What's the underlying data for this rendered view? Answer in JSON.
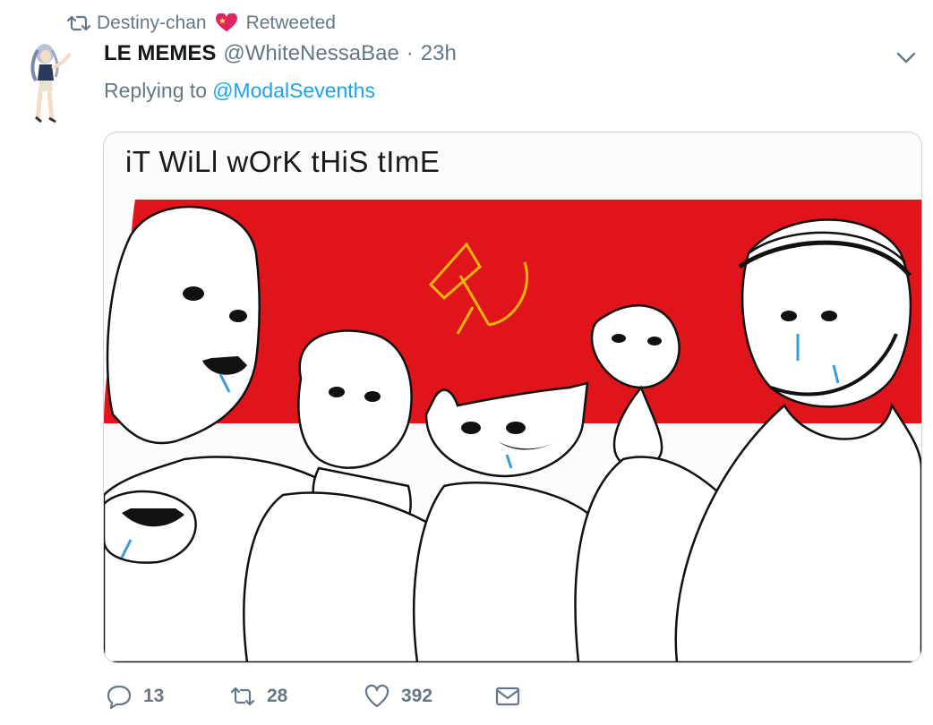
{
  "retweet_context": {
    "retweeter": "Destiny-chan",
    "label": "Retweeted"
  },
  "tweet": {
    "display_name": "LE MEMES",
    "handle": "@WhiteNessaBae",
    "separator": "·",
    "time": "23h",
    "replying_prefix": "Replying to",
    "replying_to": "@ModalSevenths",
    "media": {
      "caption": "iT WiLl wOrK tHiS tImE"
    }
  },
  "actions": {
    "replies": "13",
    "retweets": "28",
    "likes": "392"
  },
  "colors": {
    "secondary_text": "#657786",
    "link": "#1da1f2",
    "meme_red": "#e0141b",
    "hammer_sickle": "#f2b705"
  },
  "icons": [
    "retweet-icon",
    "heart-emoji-icon",
    "caret-down-icon",
    "reply-icon",
    "like-icon",
    "message-icon"
  ]
}
